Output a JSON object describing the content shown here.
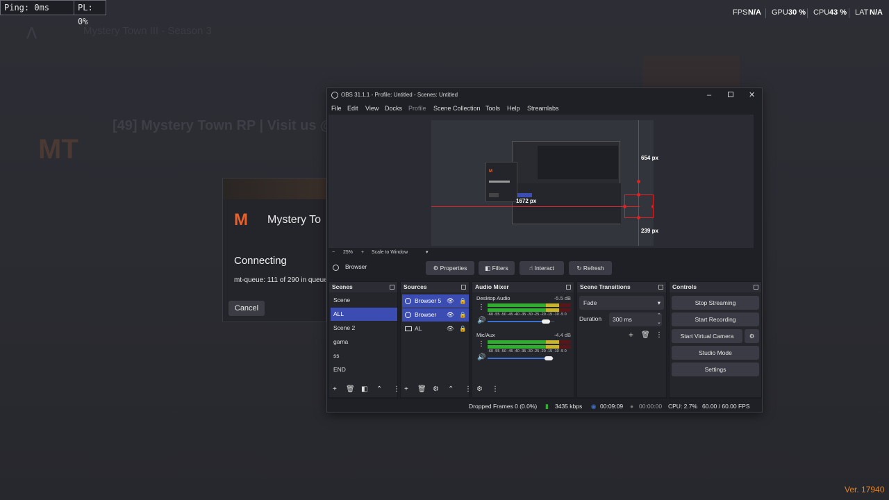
{
  "hud": {
    "ping": "Ping: 0ms",
    "packet_loss": "PL: 0%"
  },
  "perf": {
    "fps_label": "FPS",
    "fps_value": "N/A",
    "gpu_label": "GPU",
    "gpu_value": "30 %",
    "cpu_label": "CPU",
    "cpu_value": "43 %",
    "lat_label": "LAT",
    "lat_value": "N/A"
  },
  "background": {
    "server_title": "[49] Mystery Town RP | Visit us @",
    "window_title": "Mystery Town III - Season 3",
    "version": "Ver. 17940"
  },
  "dialog": {
    "brand": "Mystery To",
    "heading": "Connecting",
    "queue_text": "mt-queue: 111 of 290 in queue",
    "cancel_label": "Cancel"
  },
  "obs": {
    "title": "OBS 31.1.1 - Profile: Untitled - Scenes: Untitled",
    "menu": [
      "File",
      "Edit",
      "View",
      "Docks",
      "Profile",
      "Scene Collection",
      "Tools",
      "Help",
      "Streamlabs"
    ],
    "preview": {
      "label_top": "654 px",
      "label_left": "1672 px",
      "label_bottom": "239 px"
    },
    "zoom": {
      "minus": "−",
      "percent": "25%",
      "plus": "+",
      "mode": "Scale to Window"
    },
    "source_bar": {
      "selected": "Browser",
      "properties": "Properties",
      "filters": "Filters",
      "interact": "Interact",
      "refresh": "Refresh"
    },
    "scenes": {
      "header": "Scenes",
      "items": [
        "Scene",
        "ALL",
        "Scene 2",
        "gama",
        "ss",
        "END"
      ],
      "selected_index": 1
    },
    "sources": {
      "header": "Sources",
      "items": [
        "Browser 5",
        "Browser",
        "AL"
      ]
    },
    "audio": {
      "header": "Audio Mixer",
      "channels": [
        {
          "name": "Desktop Audio",
          "db": "-5.5 dB",
          "level": 0.86,
          "volume": 0.88
        },
        {
          "name": "Mic/Aux",
          "db": "-4.4 dB",
          "level": 0.86,
          "volume": 0.92
        }
      ],
      "ticks": "-60 -55 -50 -45 -40 -35 -30 -25 -20 -15 -10 -5 0"
    },
    "transitions": {
      "header": "Scene Transitions",
      "type": "Fade",
      "duration_label": "Duration",
      "duration_value": "300 ms"
    },
    "controls": {
      "header": "Controls",
      "stop_streaming": "Stop Streaming",
      "start_recording": "Start Recording",
      "start_virtual_camera": "Start Virtual Camera",
      "studio_mode": "Studio Mode",
      "settings": "Settings"
    },
    "status": {
      "dropped_frames": "Dropped Frames 0 (0.0%)",
      "bitrate": "3435 kbps",
      "stream_time": "00:09:09",
      "rec_time": "00:00:00",
      "cpu": "CPU: 2.7%",
      "fps": "60.00 / 60.00 FPS"
    },
    "colors": {
      "accent": "#3b4db3",
      "guide": "#e02121",
      "meter_green": "#2fae2f",
      "meter_yellow": "#c9b52a",
      "meter_red": "#b8232a"
    }
  }
}
